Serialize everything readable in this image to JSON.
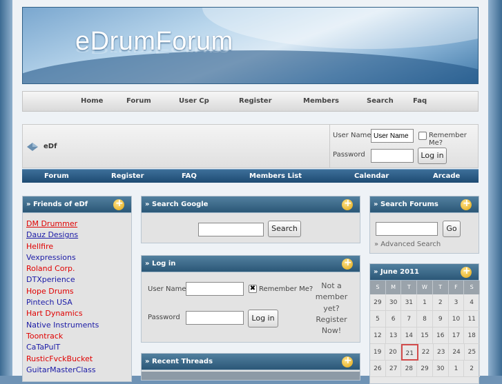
{
  "site": {
    "logo": "eDrumForum"
  },
  "topnav": [
    "Home",
    "Forum",
    "User Cp",
    "Register",
    "Members",
    "Search",
    "Faq"
  ],
  "breadcrumb": "eDf",
  "login_top": {
    "username_label": "User Name",
    "username_value": "User Name",
    "remember_label": "Remember Me?",
    "password_label": "Password",
    "button": "Log in"
  },
  "mainnav": [
    "Forum",
    "Register",
    "FAQ",
    "Members List",
    "Calendar",
    "Arcade"
  ],
  "friends": {
    "title": "» Friends of eDf",
    "links": [
      {
        "label": "DM Drummer",
        "color": "red"
      },
      {
        "label": "Dauz Designs",
        "color": "blue"
      },
      {
        "label": "Hellfire",
        "color": "red"
      },
      {
        "label": "Vexpressions",
        "color": "blue"
      },
      {
        "label": "Roland Corp.",
        "color": "red"
      },
      {
        "label": "DTXperience",
        "color": "blue"
      },
      {
        "label": "Hope Drums",
        "color": "red"
      },
      {
        "label": "Pintech USA",
        "color": "blue"
      },
      {
        "label": "Hart Dynamics",
        "color": "red"
      },
      {
        "label": "Native Instruments",
        "color": "blue"
      },
      {
        "label": "Toontrack",
        "color": "red"
      },
      {
        "label": "CaTaPulT",
        "color": "blue"
      },
      {
        "label": "RusticFvckBucket",
        "color": "red"
      },
      {
        "label": "GuitarMasterClass",
        "color": "blue"
      }
    ]
  },
  "google": {
    "title": "» Search Google",
    "button": "Search"
  },
  "login_panel": {
    "title": "» Log in",
    "username_label": "User Name",
    "remember_label": "Remember Me?",
    "password_label": "Password",
    "button": "Log in",
    "register_text": "Not a member yet? Register Now!"
  },
  "recent": {
    "title": "» Recent Threads"
  },
  "search_forums": {
    "title": "» Search Forums",
    "button": "Go",
    "advanced": "» Advanced Search"
  },
  "calendar": {
    "title": "» June 2011",
    "days": [
      "S",
      "M",
      "T",
      "W",
      "T",
      "F",
      "S"
    ],
    "weeks": [
      [
        "29",
        "30",
        "31",
        "1",
        "2",
        "3",
        "4"
      ],
      [
        "5",
        "6",
        "7",
        "8",
        "9",
        "10",
        "11"
      ],
      [
        "12",
        "13",
        "14",
        "15",
        "16",
        "17",
        "18"
      ],
      [
        "19",
        "20",
        "21",
        "22",
        "23",
        "24",
        "25"
      ],
      [
        "26",
        "27",
        "28",
        "29",
        "30",
        "1",
        "2"
      ]
    ],
    "today": "21"
  },
  "colors": {
    "nav_dark": "#1e4b73",
    "link_red": "#e00000",
    "link_blue": "#1a1aa6",
    "today_border": "#d24a4a"
  }
}
